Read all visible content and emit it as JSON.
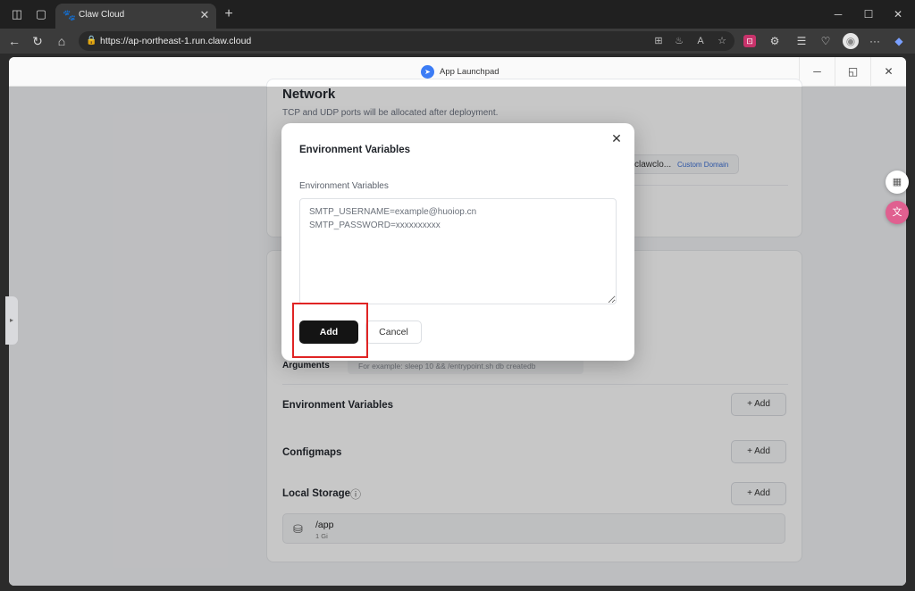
{
  "browser": {
    "tab_title": "Claw Cloud",
    "url": "https://ap-northeast-1.run.claw.cloud",
    "icons": {
      "workspaces": "◫",
      "tab_actions": "▢",
      "tab_favicon": "🐾",
      "tab_close": "✕",
      "new_tab": "+",
      "minimize": "─",
      "maximize": "☐",
      "close_window": "✕",
      "back": "←",
      "refresh": "↻",
      "home": "⌂",
      "lock": "🔒",
      "apps": "⊞",
      "immersive_reader": "♨",
      "read_aloud": "A",
      "favorite": "☆",
      "extension": "⊡",
      "puzzle": "⚙",
      "favorites_list": "☰",
      "health": "♡",
      "profile": "◉",
      "more": "···",
      "copilot": "◆"
    }
  },
  "app": {
    "header_title": "App Launchpad",
    "icons": {
      "logo": "➤",
      "minimize": "─",
      "restore": "◱",
      "close": "✕",
      "side_tab": "▸",
      "float_grid": "▦",
      "float_translate": "文"
    },
    "network": {
      "title": "Network",
      "subtitle": "TCP and UDP ports will be allocated after deployment.",
      "domain_partial": "clawclo...",
      "custom_domain": "Custom Domain"
    },
    "advanced": {
      "arguments_label": "Arguments",
      "arguments_placeholder": "For example:  sleep 10 && /entrypoint.sh db createdb",
      "env_label": "Environment Variables",
      "configmaps_label": "Configmaps",
      "storage_label": "Local Storage",
      "info_icon": "ⓘ",
      "add_label": "+  Add",
      "storage_item": {
        "path": "/app",
        "size": "1 Gi",
        "icon": "⛁"
      }
    }
  },
  "modal": {
    "title": "Environment Variables",
    "close_icon": "✕",
    "field_label": "Environment Variables",
    "textarea_value": "SMTP_USERNAME=example@huoiop.cn\nSMTP_PASSWORD=xxxxxxxxxx",
    "add_button": "Add",
    "cancel_button": "Cancel"
  },
  "colors": {
    "highlight": "#e02424",
    "primary_button": "#141414",
    "custom_domain_link": "#3b6fd4"
  }
}
